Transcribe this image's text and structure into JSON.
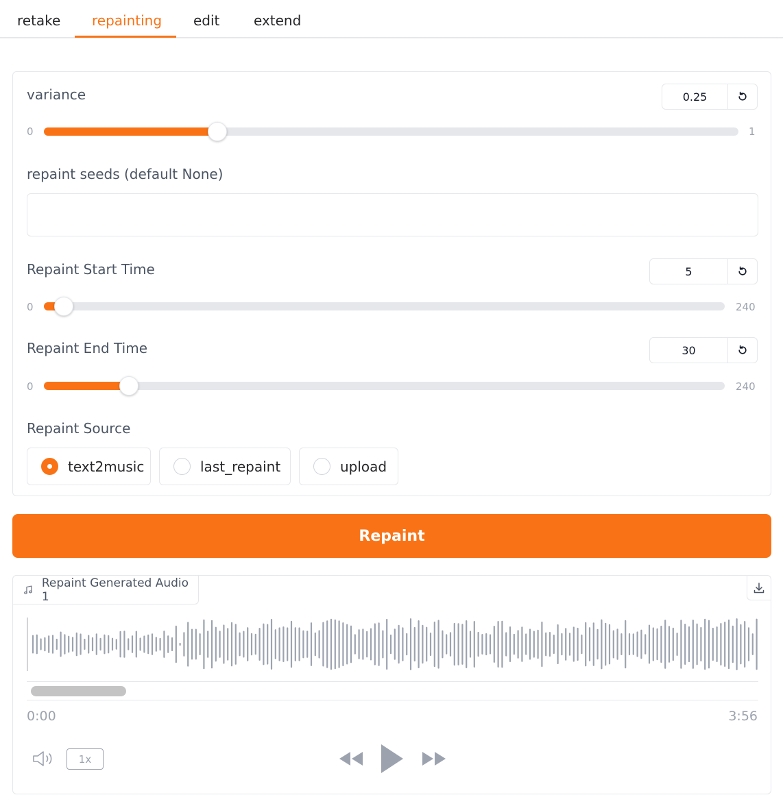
{
  "tabs": [
    {
      "label": "retake",
      "active": false
    },
    {
      "label": "repainting",
      "active": true
    },
    {
      "label": "edit",
      "active": false
    },
    {
      "label": "extend",
      "active": false
    }
  ],
  "variance": {
    "label": "variance",
    "value": "0.25",
    "min": "0",
    "max": "1",
    "fraction": 0.25
  },
  "repaint_seeds": {
    "label": "repaint seeds (default None)",
    "value": ""
  },
  "start_time": {
    "label": "Repaint Start Time",
    "value": "5",
    "min": "0",
    "max": "240",
    "fraction": 0.0208
  },
  "end_time": {
    "label": "Repaint End Time",
    "value": "30",
    "min": "0",
    "max": "240",
    "fraction": 0.125
  },
  "repaint_source": {
    "label": "Repaint Source",
    "options": [
      "text2music",
      "last_repaint",
      "upload"
    ],
    "selected": "text2music"
  },
  "repaint_button": "Repaint",
  "audio": {
    "label": "Repaint Generated Audio 1",
    "current_time": "0:00",
    "duration": "3:56",
    "speed": "1x"
  },
  "colors": {
    "accent": "#f97316",
    "wave": "#9ca3af",
    "border": "#e5e7eb"
  },
  "icons": [
    "reset-icon",
    "music-note-icon",
    "download-icon",
    "volume-icon",
    "rewind-icon",
    "play-icon",
    "fast-forward-icon"
  ]
}
